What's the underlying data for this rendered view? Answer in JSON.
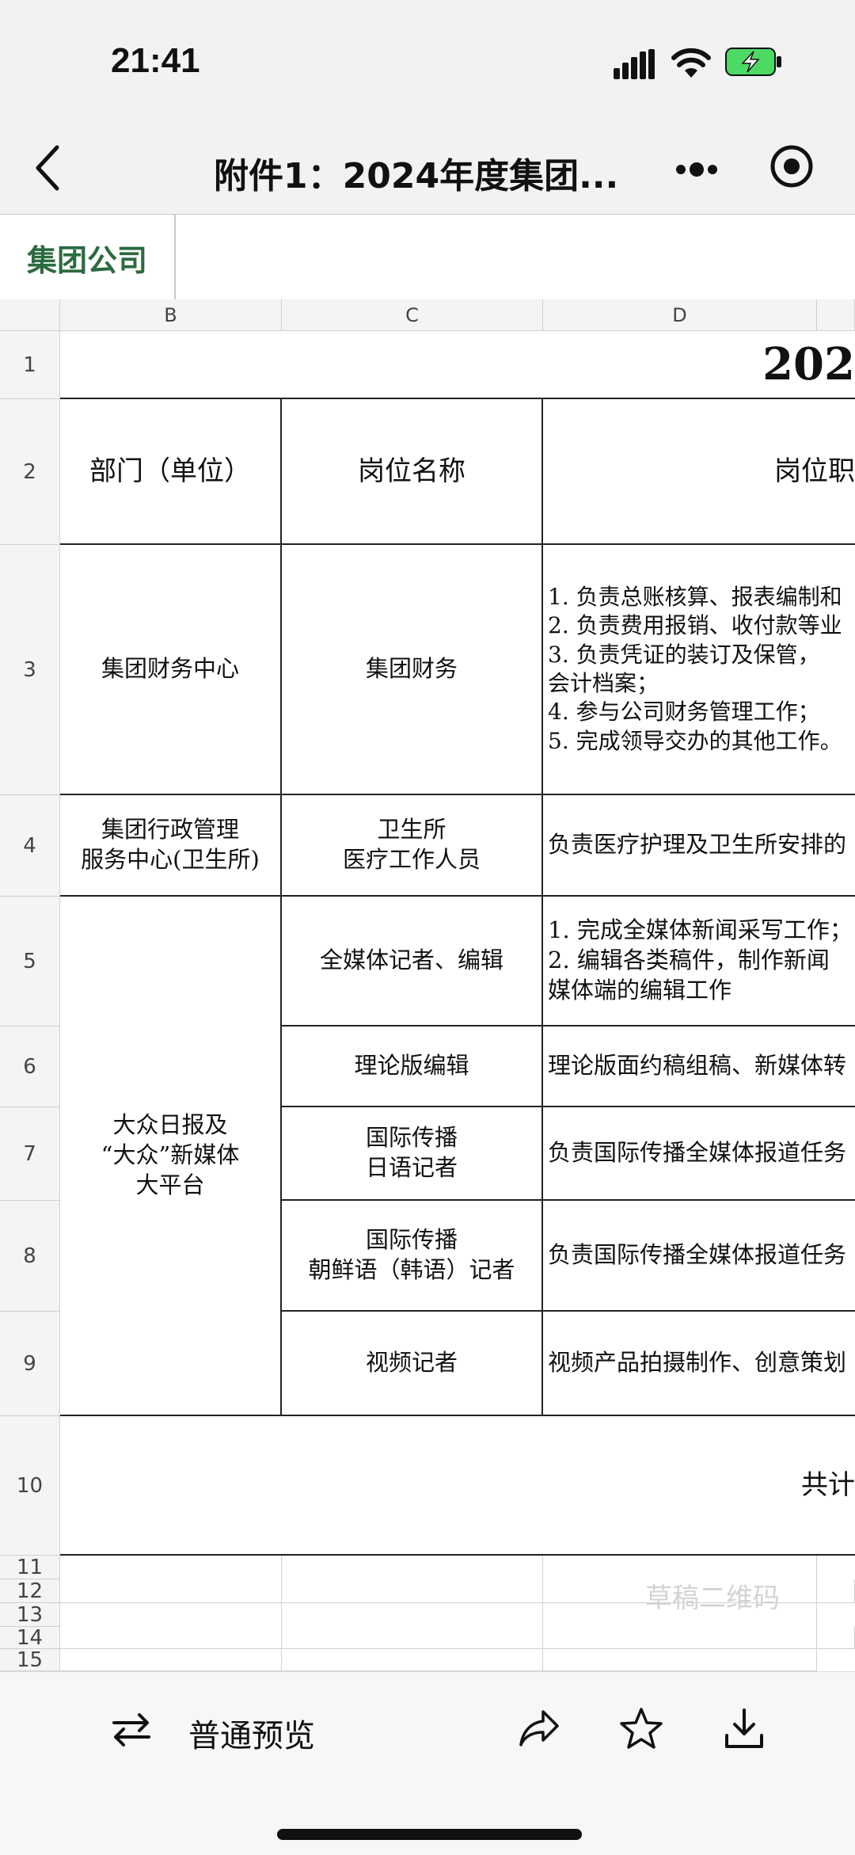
{
  "status": {
    "time": "21:41"
  },
  "nav": {
    "title": "附件1：2024年度集团..."
  },
  "sheet_tab": "集团公司",
  "columns": [
    "B",
    "C",
    "D"
  ],
  "rows": [
    "1",
    "2",
    "3",
    "4",
    "5",
    "6",
    "7",
    "8",
    "9",
    "10",
    "11",
    "12",
    "13",
    "14",
    "15"
  ],
  "table": {
    "r1_title": "202",
    "header": {
      "dept": "部门（单位）",
      "post": "岗位名称",
      "duty": "岗位职"
    },
    "r3": {
      "dept": "集团财务中心",
      "post": "集团财务",
      "duty": "1. 负责总账核算、报表编制和\n2. 负责费用报销、收付款等业\n3. 负责凭证的装订及保管，\n会计档案；\n4. 参与公司财务管理工作；\n5. 完成领导交办的其他工作。"
    },
    "r4": {
      "dept": "集团行政管理\n服务中心(卫生所)",
      "post": "卫生所\n医疗工作人员",
      "duty": "负责医疗护理及卫生所安排的"
    },
    "r5_9_dept": "大众日报及\n“大众”新媒体\n大平台",
    "r5": {
      "post": "全媒体记者、编辑",
      "duty": "1. 完成全媒体新闻采写工作；\n2. 编辑各类稿件，制作新闻\n媒体端的编辑工作"
    },
    "r6": {
      "post": "理论版编辑",
      "duty": "理论版面约稿组稿、新媒体转"
    },
    "r7": {
      "post": "国际传播\n日语记者",
      "duty": "负责国际传播全媒体报道任务"
    },
    "r8": {
      "post": "国际传播\n朝鲜语（韩语）记者",
      "duty": "负责国际传播全媒体报道任务"
    },
    "r9": {
      "post": "视频记者",
      "duty": "视频产品拍摄制作、创意策划"
    },
    "r10_total": "共计"
  },
  "watermark": "草稿二维码",
  "toolbar": {
    "preview_label": "普通预览"
  }
}
